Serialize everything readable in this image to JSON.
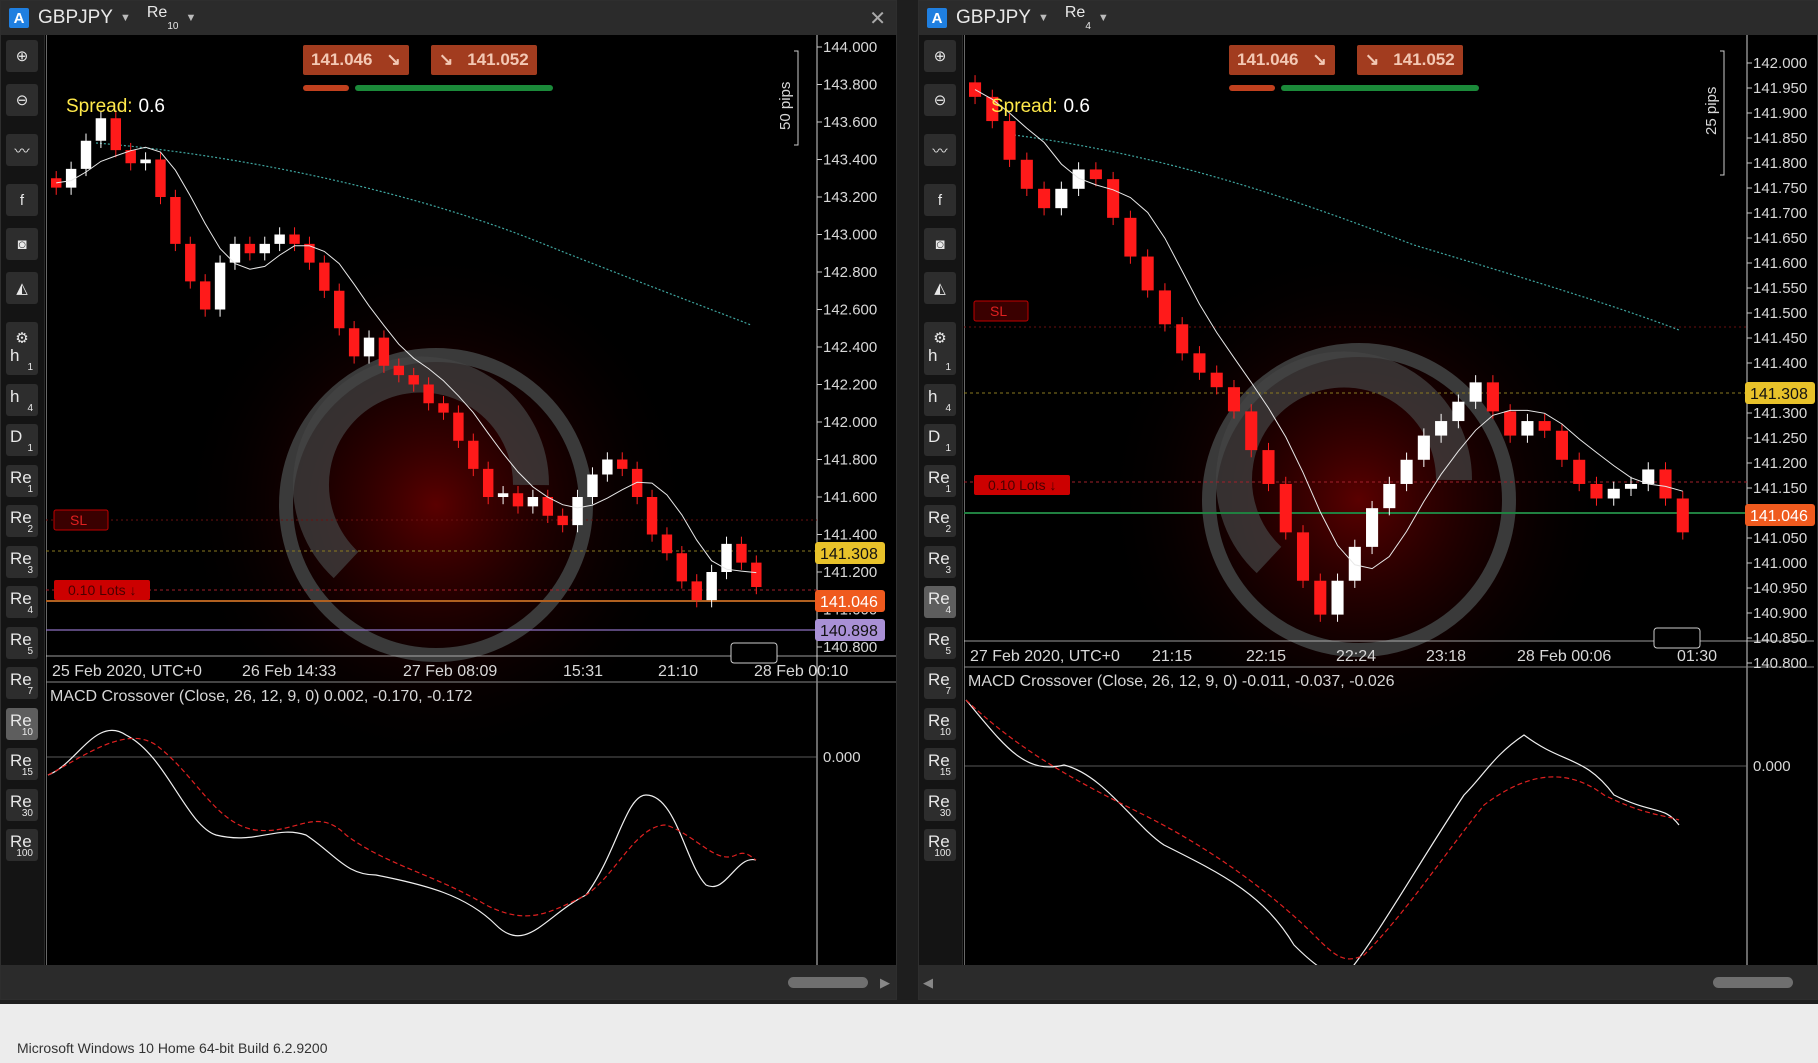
{
  "status": "Microsoft Windows 10 Home 64-bit Build 6.2.9200",
  "toolbar": {
    "tools": [
      "zoom-in-icon",
      "zoom-out-icon",
      "indicator-icon",
      "facebook-icon",
      "robot-icon",
      "theme-icon",
      "chart-settings-icon"
    ],
    "timeframes": [
      {
        "main": "h",
        "sub": "1"
      },
      {
        "main": "h",
        "sub": "4"
      },
      {
        "main": "D",
        "sub": "1"
      },
      {
        "main": "Re",
        "sub": "1"
      },
      {
        "main": "Re",
        "sub": "2"
      },
      {
        "main": "Re",
        "sub": "3"
      },
      {
        "main": "Re",
        "sub": "4"
      },
      {
        "main": "Re",
        "sub": "5"
      },
      {
        "main": "Re",
        "sub": "7"
      },
      {
        "main": "Re",
        "sub": "10"
      },
      {
        "main": "Re",
        "sub": "15"
      },
      {
        "main": "Re",
        "sub": "30"
      },
      {
        "main": "Re",
        "sub": "100"
      }
    ]
  },
  "panels": [
    {
      "symbol": "GBPJPY",
      "badge": "A",
      "timeframe_main": "Re",
      "timeframe_sub": "10",
      "active_timeframe": "10",
      "sell_price": "141.046",
      "buy_price": "141.052",
      "spread_label": "Spread:",
      "spread_value": "0.6",
      "pips_label": "50 pips",
      "sl_label": "SL",
      "lots_label": "0.10 Lots",
      "price_ticks": [
        "144.000",
        "143.800",
        "143.600",
        "143.400",
        "143.200",
        "143.000",
        "142.800",
        "142.600",
        "142.400",
        "142.200",
        "142.000",
        "141.800",
        "141.600",
        "141.400",
        "141.200",
        "141.000",
        "140.800"
      ],
      "price_tags": [
        {
          "value": "141.308",
          "color": "#e8c22a"
        },
        {
          "value": "141.046",
          "color": "#ef5a1e"
        },
        {
          "value": "140.898",
          "color": "#a990d6"
        }
      ],
      "time_ticks": [
        "25 Feb 2020, UTC+0",
        "26 Feb 14:33",
        "27 Feb 08:09",
        "15:31",
        "21:10",
        "28 Feb 00:10"
      ],
      "macd_label": "MACD Crossover (Close, 26, 12, 9, 0) 0.002, -0.170, -0.172",
      "macd_zero": "0.000",
      "has_close": true,
      "chart_data": {
        "type": "candlestick",
        "ylim": [
          140.8,
          144.0
        ],
        "close": [
          143.25,
          143.35,
          143.5,
          143.62,
          143.45,
          143.38,
          143.4,
          143.2,
          142.95,
          142.75,
          142.6,
          142.85,
          142.95,
          142.9,
          142.95,
          143.0,
          142.95,
          142.85,
          142.7,
          142.5,
          142.35,
          142.45,
          142.3,
          142.25,
          142.2,
          142.1,
          142.05,
          141.9,
          141.75,
          141.6,
          141.62,
          141.55,
          141.6,
          141.5,
          141.45,
          141.6,
          141.72,
          141.8,
          141.75,
          141.6,
          141.4,
          141.3,
          141.15,
          141.05,
          141.2,
          141.35,
          141.25,
          141.12
        ]
      }
    },
    {
      "symbol": "GBPJPY",
      "badge": "A",
      "timeframe_main": "Re",
      "timeframe_sub": "4",
      "active_timeframe": "4",
      "sell_price": "141.046",
      "buy_price": "141.052",
      "spread_label": "Spread:",
      "spread_value": "0.6",
      "pips_label": "25 pips",
      "sl_label": "SL",
      "lots_label": "0.10 Lots",
      "price_ticks": [
        "142.000",
        "141.950",
        "141.900",
        "141.850",
        "141.800",
        "141.750",
        "141.700",
        "141.650",
        "141.600",
        "141.550",
        "141.500",
        "141.450",
        "141.400",
        "141.350",
        "141.300",
        "141.250",
        "141.200",
        "141.150",
        "141.100",
        "141.050",
        "141.000",
        "140.950",
        "140.900",
        "140.850",
        "140.800"
      ],
      "price_tags": [
        {
          "value": "141.308",
          "color": "#e8c22a"
        },
        {
          "value": "141.046",
          "color": "#ef5a1e"
        }
      ],
      "time_ticks": [
        "27 Feb 2020, UTC+0",
        "21:15",
        "22:15",
        "22:24",
        "23:18",
        "28 Feb 00:06",
        "01:30"
      ],
      "macd_label": "MACD Crossover (Close, 26, 12, 9, 0) -0.011, -0.037, -0.026",
      "macd_zero": "0.000",
      "has_close": false,
      "chart_data": {
        "type": "candlestick",
        "ylim": [
          140.78,
          142.02
        ],
        "close": [
          141.95,
          141.9,
          141.82,
          141.76,
          141.72,
          141.76,
          141.8,
          141.78,
          141.7,
          141.62,
          141.55,
          141.48,
          141.42,
          141.38,
          141.35,
          141.3,
          141.22,
          141.15,
          141.05,
          140.95,
          140.88,
          140.95,
          141.02,
          141.1,
          141.15,
          141.2,
          141.25,
          141.28,
          141.32,
          141.36,
          141.3,
          141.25,
          141.28,
          141.26,
          141.2,
          141.15,
          141.12,
          141.14,
          141.15,
          141.18,
          141.12,
          141.05
        ]
      }
    }
  ]
}
